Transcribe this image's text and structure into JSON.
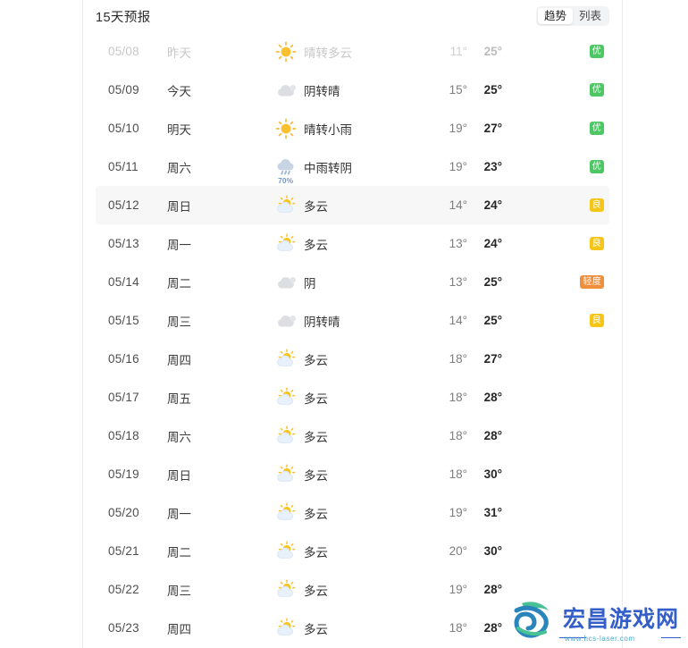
{
  "header": {
    "title": "15天预报",
    "toggle": {
      "options": [
        "趋势",
        "列表"
      ],
      "selected": "趋势"
    }
  },
  "colors": {
    "aqi_excellent": "#4cc764",
    "aqi_good": "#f5c518",
    "aqi_light": "#ef8f3c",
    "accent_rain": "#6e9ad6",
    "row_highlight": "#f7f7f8"
  },
  "rows": [
    {
      "date": "05/08",
      "day": "昨天",
      "icon": "sun-icon",
      "desc": "晴转多云",
      "low": "11°",
      "high": "25°",
      "aqi": "优",
      "aqi_level": "excellent",
      "pop": "",
      "past": true,
      "highlight": false
    },
    {
      "date": "05/09",
      "day": "今天",
      "icon": "cloud-icon",
      "desc": "阴转晴",
      "low": "15°",
      "high": "25°",
      "aqi": "优",
      "aqi_level": "excellent",
      "pop": "",
      "past": false,
      "highlight": false
    },
    {
      "date": "05/10",
      "day": "明天",
      "icon": "sun-icon",
      "desc": "晴转小雨",
      "low": "19°",
      "high": "27°",
      "aqi": "优",
      "aqi_level": "excellent",
      "pop": "",
      "past": false,
      "highlight": false
    },
    {
      "date": "05/11",
      "day": "周六",
      "icon": "rain-icon",
      "desc": "中雨转阴",
      "low": "19°",
      "high": "23°",
      "aqi": "优",
      "aqi_level": "excellent",
      "pop": "70%",
      "past": false,
      "highlight": false
    },
    {
      "date": "05/12",
      "day": "周日",
      "icon": "partly-cloudy-icon",
      "desc": "多云",
      "low": "14°",
      "high": "24°",
      "aqi": "良",
      "aqi_level": "good",
      "pop": "",
      "past": false,
      "highlight": true
    },
    {
      "date": "05/13",
      "day": "周一",
      "icon": "partly-cloudy-icon",
      "desc": "多云",
      "low": "13°",
      "high": "24°",
      "aqi": "良",
      "aqi_level": "good",
      "pop": "",
      "past": false,
      "highlight": false
    },
    {
      "date": "05/14",
      "day": "周二",
      "icon": "cloud-icon",
      "desc": "阴",
      "low": "13°",
      "high": "25°",
      "aqi": "轻度",
      "aqi_level": "light",
      "pop": "",
      "past": false,
      "highlight": false
    },
    {
      "date": "05/15",
      "day": "周三",
      "icon": "cloud-icon",
      "desc": "阴转晴",
      "low": "14°",
      "high": "25°",
      "aqi": "良",
      "aqi_level": "good",
      "pop": "",
      "past": false,
      "highlight": false
    },
    {
      "date": "05/16",
      "day": "周四",
      "icon": "partly-cloudy-icon",
      "desc": "多云",
      "low": "18°",
      "high": "27°",
      "aqi": "",
      "aqi_level": "",
      "pop": "",
      "past": false,
      "highlight": false
    },
    {
      "date": "05/17",
      "day": "周五",
      "icon": "partly-cloudy-icon",
      "desc": "多云",
      "low": "18°",
      "high": "28°",
      "aqi": "",
      "aqi_level": "",
      "pop": "",
      "past": false,
      "highlight": false
    },
    {
      "date": "05/18",
      "day": "周六",
      "icon": "partly-cloudy-icon",
      "desc": "多云",
      "low": "18°",
      "high": "28°",
      "aqi": "",
      "aqi_level": "",
      "pop": "",
      "past": false,
      "highlight": false
    },
    {
      "date": "05/19",
      "day": "周日",
      "icon": "partly-cloudy-icon",
      "desc": "多云",
      "low": "18°",
      "high": "30°",
      "aqi": "",
      "aqi_level": "",
      "pop": "",
      "past": false,
      "highlight": false
    },
    {
      "date": "05/20",
      "day": "周一",
      "icon": "partly-cloudy-icon",
      "desc": "多云",
      "low": "19°",
      "high": "31°",
      "aqi": "",
      "aqi_level": "",
      "pop": "",
      "past": false,
      "highlight": false
    },
    {
      "date": "05/21",
      "day": "周二",
      "icon": "partly-cloudy-icon",
      "desc": "多云",
      "low": "20°",
      "high": "30°",
      "aqi": "",
      "aqi_level": "",
      "pop": "",
      "past": false,
      "highlight": false
    },
    {
      "date": "05/22",
      "day": "周三",
      "icon": "partly-cloudy-icon",
      "desc": "多云",
      "low": "19°",
      "high": "28°",
      "aqi": "",
      "aqi_level": "",
      "pop": "",
      "past": false,
      "highlight": false
    },
    {
      "date": "05/23",
      "day": "周四",
      "icon": "partly-cloudy-icon",
      "desc": "多云",
      "low": "18°",
      "high": "28°",
      "aqi": "",
      "aqi_level": "",
      "pop": "",
      "past": false,
      "highlight": false
    }
  ],
  "watermark": {
    "text": "宏昌游戏网",
    "url": "www.hcs-laser.com"
  }
}
